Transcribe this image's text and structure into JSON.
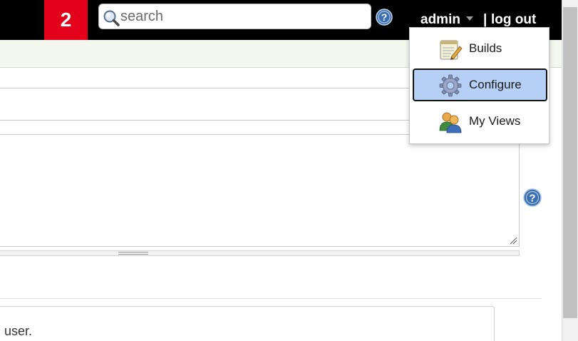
{
  "header": {
    "badge": "2",
    "search": {
      "placeholder": "search",
      "value": ""
    },
    "user_label": "admin",
    "separator": "|",
    "logout_label": "log out"
  },
  "user_menu": {
    "items": [
      {
        "label": "Builds",
        "icon": "notepad-icon",
        "active": false
      },
      {
        "label": "Configure",
        "icon": "gear-icon",
        "active": true
      },
      {
        "label": "My Views",
        "icon": "users-icon",
        "active": false
      }
    ]
  },
  "form": {
    "text_value": "",
    "textarea_value": "",
    "note_text": "user."
  },
  "colors": {
    "topbar": "#000000",
    "badge": "#e2001a",
    "menu_highlight": "#b6cff5",
    "help_icon": "#3a6fb0"
  }
}
